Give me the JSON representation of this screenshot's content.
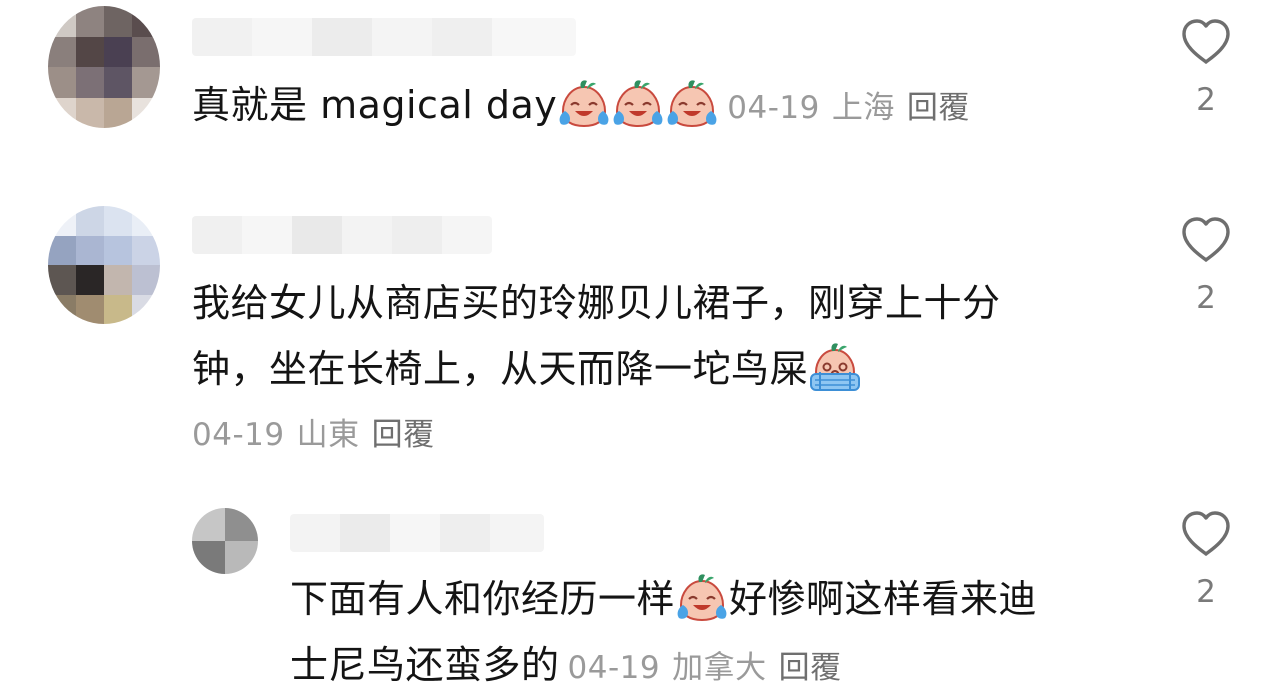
{
  "comments": [
    {
      "text": "真就是 magical day",
      "emoji": "laughing-crying-emoji",
      "date": "04-19",
      "location": "上海",
      "reply_label": "回覆",
      "likes": "2"
    },
    {
      "text_line1": "我给女儿从商店买的玲娜贝儿裙子，刚穿上十分",
      "text_line2": "钟，坐在长椅上，从天而降一坨鸟屎",
      "emoji": "crying-emoji",
      "date": "04-19",
      "location": "山東",
      "reply_label": "回覆",
      "likes": "2"
    },
    {
      "text_line1a": "下面有人和你经历一样",
      "text_line1b": "好惨啊这样看来迪",
      "text_line2": "士尼鸟还蛮多的",
      "emoji": "laughing-crying-emoji",
      "date": "04-19",
      "location": "加拿大",
      "reply_label": "回覆",
      "likes": "2"
    }
  ],
  "colors": {
    "text": "#141414",
    "meta": "#9a9a9a",
    "reply": "#6f6f6f",
    "icon": "#7a7a7a"
  }
}
